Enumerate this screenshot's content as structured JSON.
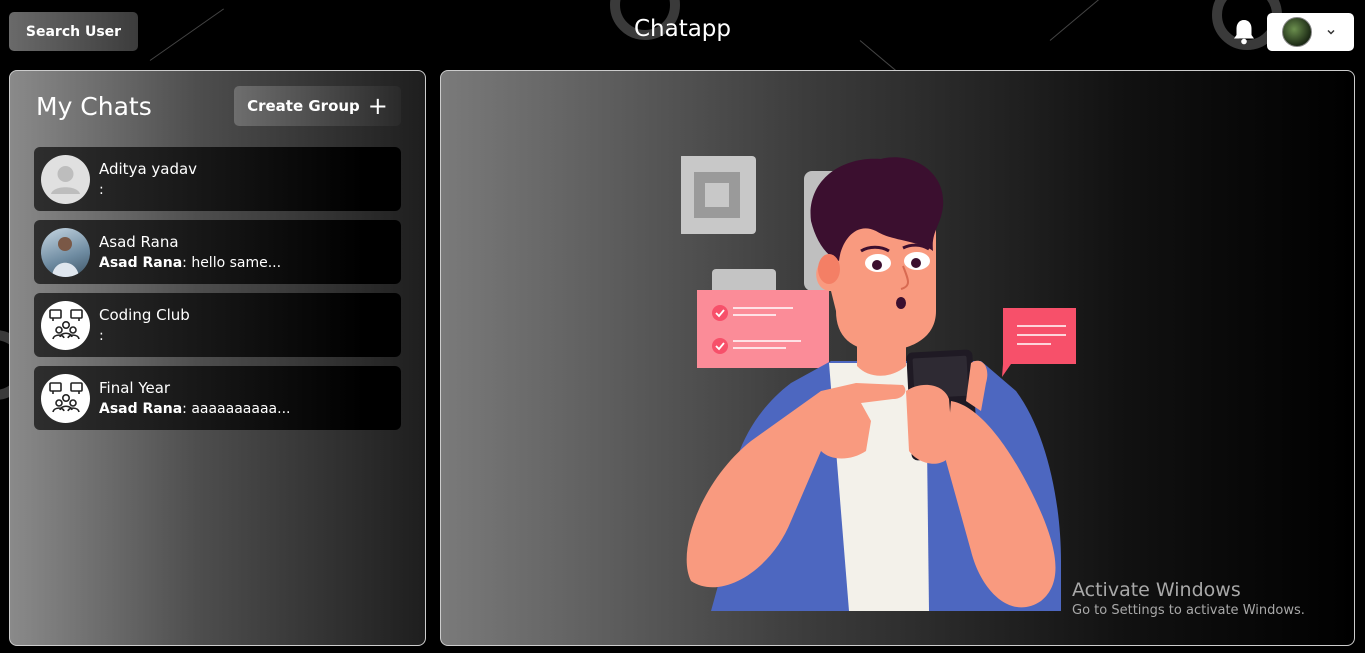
{
  "header": {
    "search_label": "Search User",
    "app_title": "Chatapp",
    "bell_icon": "bell-icon",
    "profile_chevron": "chevron-down-icon"
  },
  "sidebar": {
    "title": "My Chats",
    "create_group_label": "Create Group",
    "create_group_icon": "plus-icon",
    "chats": [
      {
        "name": "Aditya yadav",
        "sender": "",
        "last_message": ":",
        "avatar": "default-user-avatar"
      },
      {
        "name": "Asad Rana",
        "sender": "Asad Rana",
        "last_message": ": hello same...",
        "avatar": "user-photo-avatar"
      },
      {
        "name": "Coding Club",
        "sender": "",
        "last_message": ":",
        "avatar": "group-icon"
      },
      {
        "name": "Final Year",
        "sender": "Asad Rana",
        "last_message": ": aaaaaaaaaa...",
        "avatar": "group-icon"
      }
    ]
  },
  "chat_box": {
    "illustration": "person-with-phone-illustration"
  },
  "watermark": {
    "title": "Activate Windows",
    "subtitle": "Go to Settings to activate Windows."
  },
  "colors": {
    "background": "#000000",
    "panel_border": "#cccccc",
    "accent_pink": "#f7506a",
    "shirt_blue": "#4d67c0",
    "skin": "#f99a7f",
    "hair": "#3b0f2f"
  }
}
